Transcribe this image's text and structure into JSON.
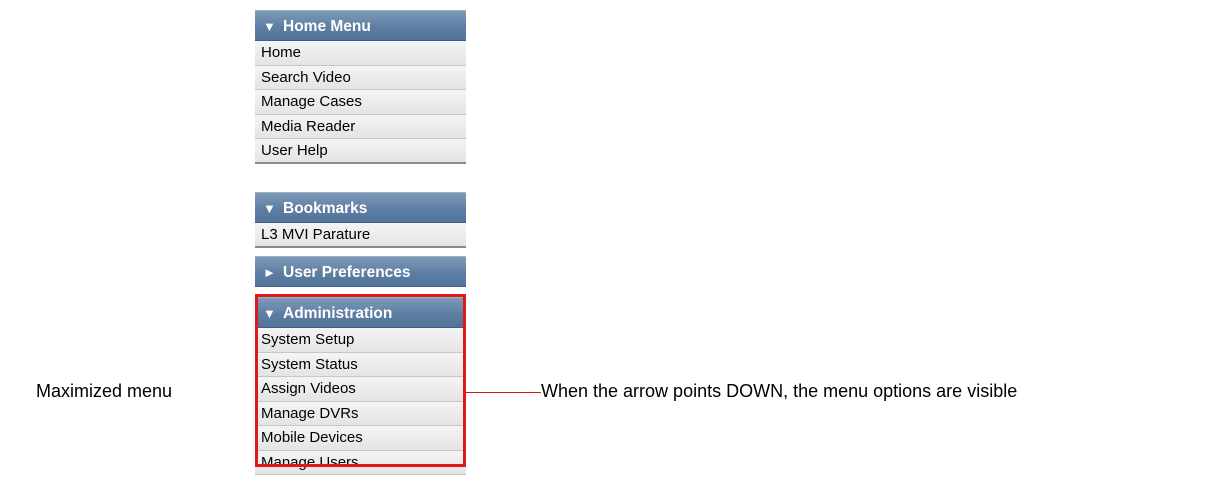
{
  "colors": {
    "header_bg": "#5e7ea2",
    "item_bg": "#e9e9e9",
    "highlight": "#e01818"
  },
  "menu": {
    "home_menu": {
      "arrow": "▼",
      "title": "Home Menu",
      "items": [
        "Home",
        "Search Video",
        "Manage Cases",
        "Media Reader",
        "User Help"
      ]
    },
    "bookmarks": {
      "arrow": "▼",
      "title": "Bookmarks",
      "items": [
        "L3 MVI Parature"
      ]
    },
    "user_preferences": {
      "arrow": "►",
      "title": "User Preferences"
    },
    "administration": {
      "arrow": "▼",
      "title": "Administration",
      "items": [
        "System Setup",
        "System Status",
        "Assign Videos",
        "Manage DVRs",
        "Mobile Devices",
        "Manage Users"
      ]
    }
  },
  "annotations": {
    "left_label": "Maximized menu",
    "callout_text": "When the arrow points DOWN, the menu options are visible"
  }
}
